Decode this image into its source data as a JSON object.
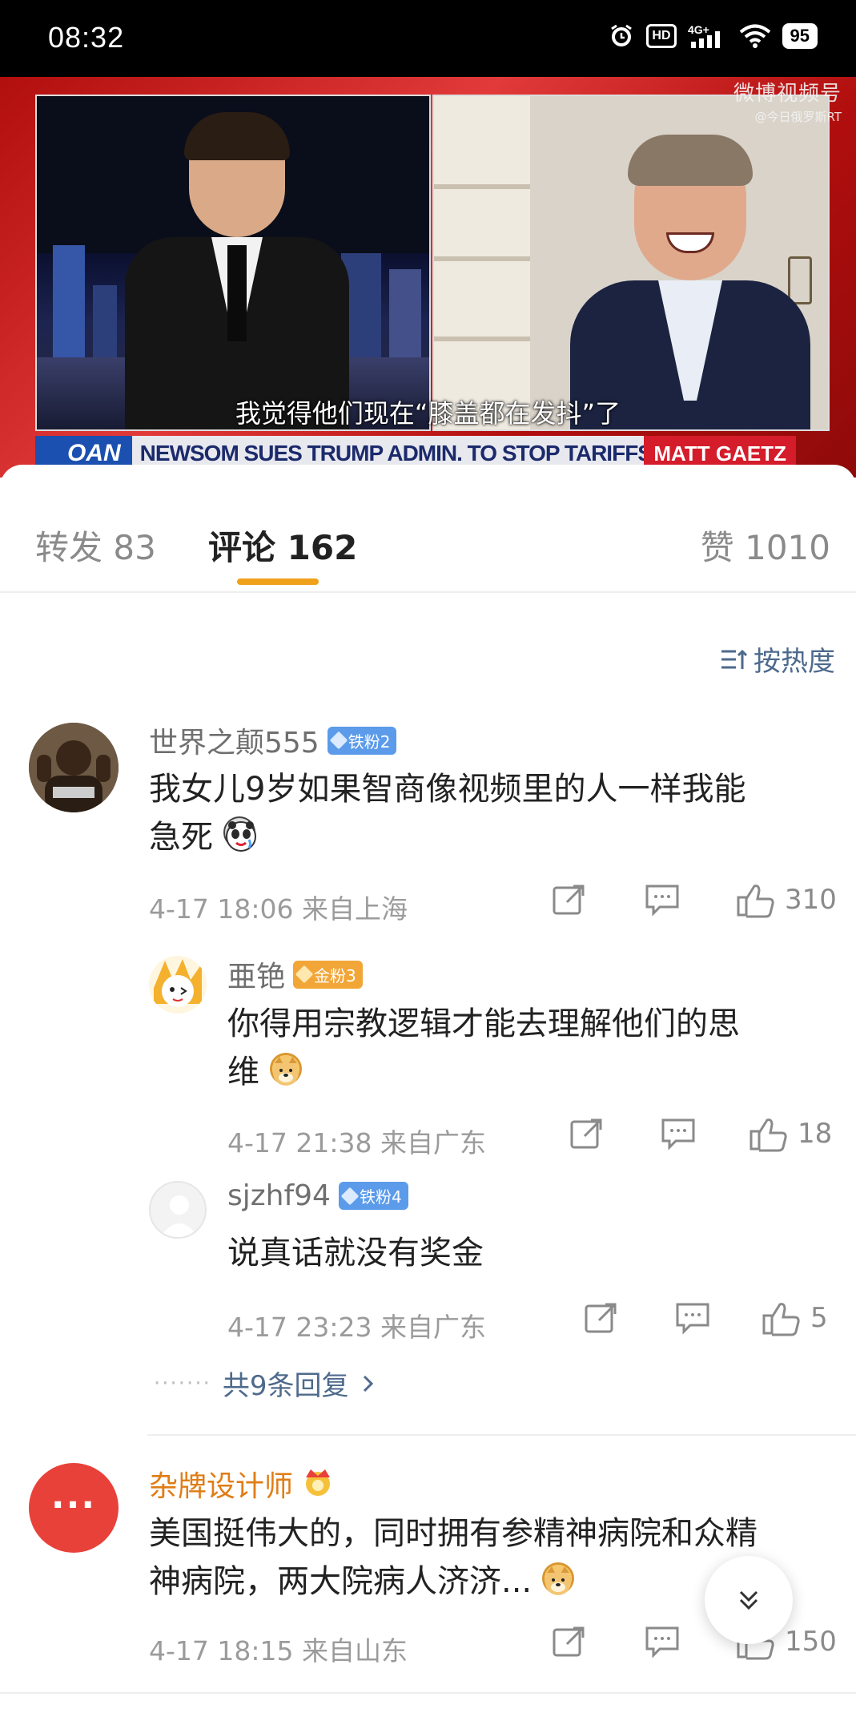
{
  "status_bar": {
    "time": "08:32",
    "battery": "95",
    "network": "4G+",
    "hd": "HD"
  },
  "video": {
    "watermark_main": "微博视频号",
    "watermark_sub": "@今日俄罗斯RT",
    "subtitle": "我觉得他们现在“膝盖都在发抖”了",
    "ticker_logo": "OAN",
    "ticker_text": "NEWSOM SUES TRUMP ADMIN. TO STOP TARIFFS",
    "ticker_badge": "MATT GAETZ"
  },
  "tabs": {
    "repost": "转发 83",
    "comments": "评论 162",
    "likes": "赞 1010"
  },
  "sort": {
    "label": "按热度"
  },
  "comments": [
    {
      "user": "世界之颠555",
      "badge": "铁粉2",
      "text_line1": "我女儿9岁如果智商像视频里的人一样我能",
      "text_line2": "急死",
      "emoji": "panda-emoji",
      "meta": "4-17 18:06  来自上海",
      "likes": "310",
      "replies": [
        {
          "user": "亜铯",
          "badge": "金粉3",
          "text_line1": "你得用宗教逻辑才能去理解他们的思",
          "text_line2": "维",
          "emoji": "doge-emoji",
          "meta": "4-17 21:38  来自广东",
          "likes": "18"
        },
        {
          "user": "sjzhf94",
          "badge": "铁粉4",
          "text_line1": "说真话就没有奖金",
          "meta": "4-17 23:23  来自广东",
          "likes": "5"
        }
      ],
      "more_replies": "共9条回复"
    },
    {
      "user": "杂牌设计师",
      "badge_icon": "crown-icon",
      "avatar_text": "···",
      "text_line1": "美国挺伟大的，同时拥有参精神病院和众精",
      "text_line2": "神病院，两大院病人济济...",
      "emoji": "doge-emoji",
      "meta": "4-17 18:15  来自山东",
      "likes": "150"
    }
  ],
  "colors": {
    "accent_underline": "#f0a11b",
    "link_blue": "#4e6a8c",
    "gold_name": "#e07d16",
    "fan_badge_blue": "#5b9bea",
    "fan_badge_gold": "#f1a637",
    "avatar_red": "#e8413a"
  }
}
